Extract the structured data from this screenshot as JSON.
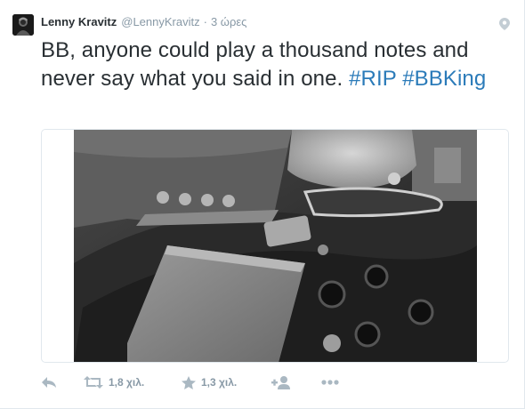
{
  "tweet": {
    "author_name": "Lenny Kravitz",
    "author_handle": "@LennyKravitz",
    "separator": "·",
    "timestamp": "3 ώρες",
    "text_plain": "BB, anyone could play a thousand notes and never say what you said in one.",
    "hashtags": [
      "#RIP",
      "#BBKing"
    ],
    "avatar_icon": "profile-photo",
    "geo_icon": "location-pin-icon",
    "media_description": "black-and-white-guitar-photo"
  },
  "actions": {
    "reply_icon": "reply-icon",
    "retweet_icon": "retweet-icon",
    "retweet_count": "1,8 χιλ.",
    "favorite_icon": "star-icon",
    "favorite_count": "1,3 χιλ.",
    "follow_icon": "follow-user-icon",
    "more_icon": "more-dots-icon"
  },
  "colors": {
    "text": "#292f33",
    "secondary": "#8899a6",
    "link": "#2b7bb9",
    "border": "#e1e8ed"
  }
}
